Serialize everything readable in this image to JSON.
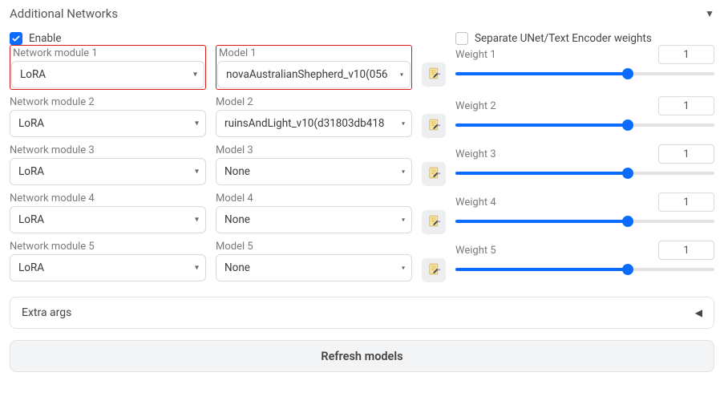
{
  "header": {
    "title": "Additional Networks"
  },
  "options": {
    "enable_label": "Enable",
    "enable_checked": true,
    "separate_label": "Separate UNet/Text Encoder weights",
    "separate_checked": false
  },
  "rows": [
    {
      "highlight": true,
      "module_label": "Network module 1",
      "module_value": "LoRA",
      "model_label": "Model 1",
      "model_value": "novaAustralianShepherd_v10(056",
      "weight_label": "Weight 1",
      "weight_value": "1"
    },
    {
      "highlight": false,
      "module_label": "Network module 2",
      "module_value": "LoRA",
      "model_label": "Model 2",
      "model_value": "ruinsAndLight_v10(d31803db418",
      "weight_label": "Weight 2",
      "weight_value": "1"
    },
    {
      "highlight": false,
      "module_label": "Network module 3",
      "module_value": "LoRA",
      "model_label": "Model 3",
      "model_value": "None",
      "weight_label": "Weight 3",
      "weight_value": "1"
    },
    {
      "highlight": false,
      "module_label": "Network module 4",
      "module_value": "LoRA",
      "model_label": "Model 4",
      "model_value": "None",
      "weight_label": "Weight 4",
      "weight_value": "1"
    },
    {
      "highlight": false,
      "module_label": "Network module 5",
      "module_value": "LoRA",
      "model_label": "Model 5",
      "model_value": "None",
      "weight_label": "Weight 5",
      "weight_value": "1"
    }
  ],
  "extra_args": {
    "label": "Extra args"
  },
  "refresh": {
    "label": "Refresh models"
  }
}
